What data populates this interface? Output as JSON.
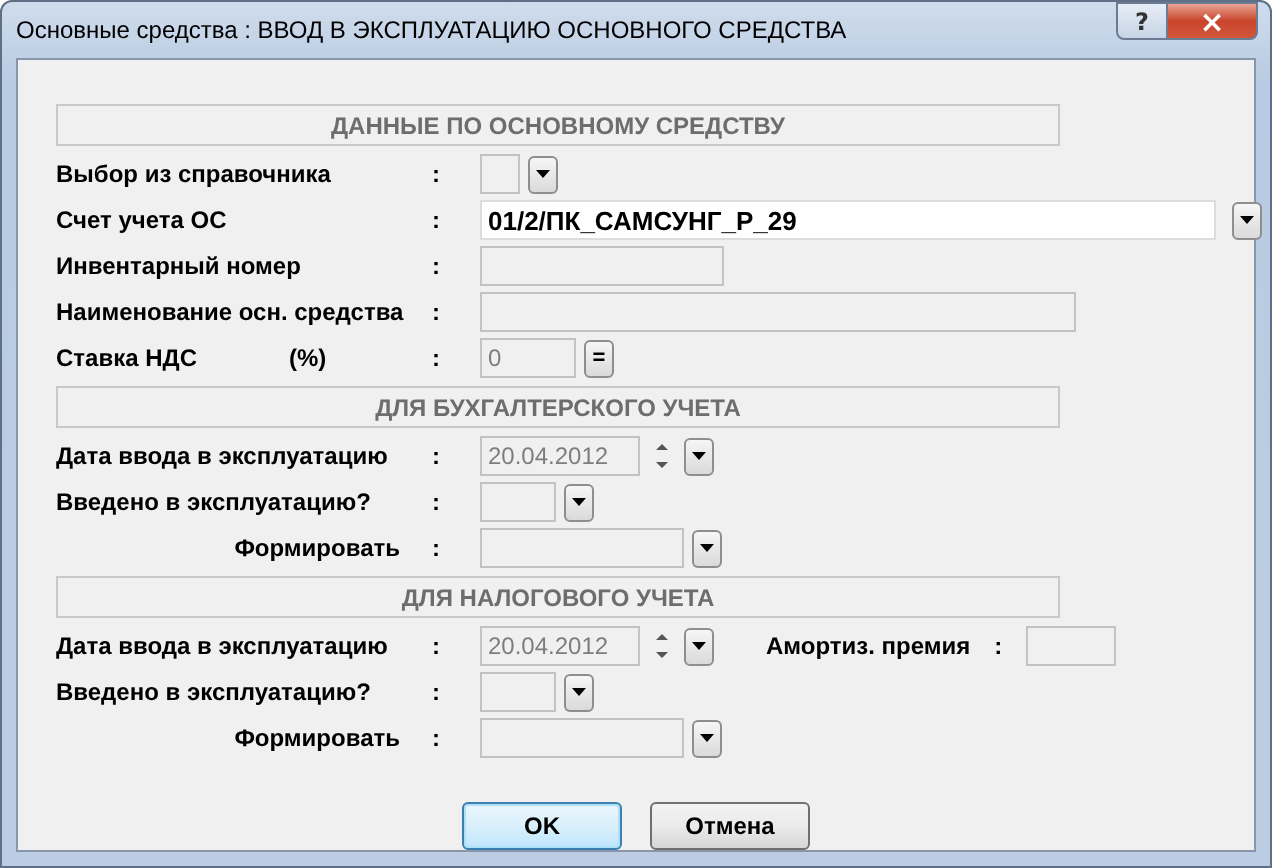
{
  "window": {
    "title": "Основные средства : ВВОД В ЭКСПЛУАТАЦИЮ ОСНОВНОГО СРЕДСТВА",
    "help": "?",
    "close": "×"
  },
  "sections": [
    {
      "title": "ДАННЫЕ ПО ОСНОВНОМУ СРЕДСТВУ",
      "rows": [
        {
          "kind": "pick",
          "label": "Выбор из справочника",
          "colon": ":",
          "disabled": true
        },
        {
          "kind": "account",
          "label": "Счет учета ОС",
          "colon": ":",
          "value": "01/2/ПК_САМСУНГ_Р_29",
          "disabled": false
        },
        {
          "kind": "inventory",
          "label": "Инвентарный номер",
          "colon": ":",
          "disabled": true
        },
        {
          "kind": "name",
          "label": "Наименование осн. средства",
          "colon": ":",
          "disabled": true
        },
        {
          "kind": "vat",
          "label": "Ставка НДС",
          "unit": "(%)",
          "colon": ":",
          "value": "0",
          "button": "=",
          "disabled": true
        }
      ]
    },
    {
      "title": "ДЛЯ БУХГАЛТЕРСКОГО УЧЕТА",
      "rows": [
        {
          "kind": "date",
          "label": "Дата ввода в эксплуатацию",
          "colon": ":",
          "value": "20.04.2012",
          "disabled": true
        },
        {
          "kind": "yesno",
          "label": "Введено в эксплуатацию?",
          "colon": ":",
          "disabled": true
        },
        {
          "kind": "generate",
          "label": "Формировать",
          "colon": ":",
          "disabled": true
        }
      ]
    },
    {
      "title": "ДЛЯ НАЛОГОВОГО УЧЕТА",
      "rows": [
        {
          "kind": "date",
          "label": "Дата ввода в эксплуатацию",
          "colon": ":",
          "value": "20.04.2012",
          "disabled": true,
          "extra": {
            "label": "Амортиз. премия",
            "colon": ":"
          }
        },
        {
          "kind": "yesno",
          "label": "Введено в эксплуатацию?",
          "colon": ":",
          "disabled": true
        },
        {
          "kind": "generate",
          "label": "Формировать",
          "colon": ":",
          "disabled": true
        }
      ]
    }
  ],
  "buttons": [
    {
      "label": "OK",
      "default": true
    },
    {
      "label": "Отмена",
      "default": false
    }
  ]
}
